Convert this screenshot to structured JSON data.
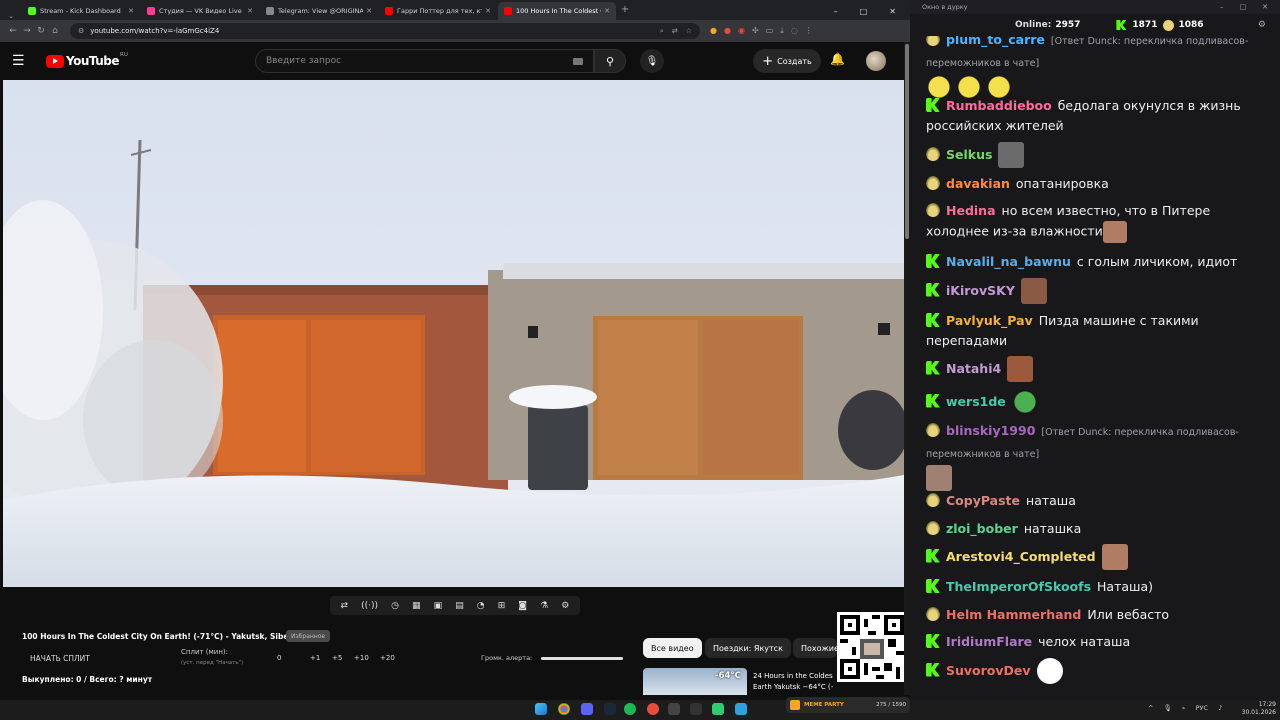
{
  "browser": {
    "tabs": [
      {
        "title": "Stream - Kick Dashboard",
        "color": "#53fc18"
      },
      {
        "title": "Студия — VK Видео Live",
        "color": "#ff3b8d"
      },
      {
        "title": "Telegram: View @ORIGINALDA",
        "color": "#888888"
      },
      {
        "title": "Гарри Поттер для тех, кто вы",
        "color": "#ff0000"
      },
      {
        "title": "100 Hours In The Coldest C",
        "color": "#ff0000"
      }
    ],
    "new_tab": "+",
    "url": "youtube.com/watch?v=-laGmGc4iZ4",
    "window_controls": [
      "–",
      "□",
      "✕"
    ]
  },
  "youtube": {
    "logo_text": "YouTube",
    "region": "RU",
    "search_placeholder": "Введите запрос",
    "create_label": "Создать"
  },
  "panel": {
    "video_title": "100 Hours In The Coldest City On Earth! (-71°C) - Yakutsk, Siberia",
    "favorite_label": "Избранное",
    "split_button": "НАЧАТЬ СПЛИТ",
    "split_label": "Сплит (мин):",
    "split_hint": "(уст. перед \"Начать\")",
    "split_values": [
      "0",
      "+1",
      "+5",
      "+10",
      "+20"
    ],
    "alert_volume_label": "Громк. алерта:",
    "alert_volume_level": 1.0,
    "bought": "Выкуплено: 0 / Всего: ? минут"
  },
  "recommendations": {
    "chips": [
      "Все видео",
      "Поездки: Якутск",
      "Похожие"
    ],
    "item_title_1": "24 Hours in the Coldest",
    "item_title_2": "Earth Yakutsk −64°C (−83°F)",
    "item_temp": "-64°C"
  },
  "chat_window": {
    "title": "Окно в дурку",
    "online_label": "Online:",
    "online_count": "2957",
    "kick_count": "1871",
    "other_count": "1086"
  },
  "chat": [
    {
      "badge": "p",
      "user": "",
      "color": "#4fb3ff",
      "text": "",
      "reply": "[Ответ Dunck: перекличка подливасов-",
      "reply2": "переможников в чате]",
      "emotes": 3
    },
    {
      "badge": "k",
      "user": "Rumbaddieboo",
      "color": "#ff6b9a",
      "text": "бедолага окунулся в жизнь российских жителей"
    },
    {
      "badge": "p",
      "user": "Selkus",
      "color": "#7bd46a",
      "text": "",
      "emote": "#6b6b6b"
    },
    {
      "badge": "p",
      "user": "davakian",
      "color": "#ff8a3d",
      "text": "опатанировка"
    },
    {
      "badge": "p",
      "user": "Hedina",
      "color": "#ff6b9a",
      "text": "но всем известно, что в Питере холоднее из-за влажности",
      "emote": "#b07c64"
    },
    {
      "badge": "k",
      "user": "Navalil_na_bawnu",
      "color": "#5dade2",
      "text": "с голым личиком, идиот"
    },
    {
      "badge": "k",
      "user": "iKirovSKY",
      "color": "#c39bd3",
      "text": "",
      "emote": "#8a5a44"
    },
    {
      "badge": "k",
      "user": "Pavlyuk_Pav",
      "color": "#f5b041",
      "text": "Пизда машине с такими перепадами"
    },
    {
      "badge": "k",
      "user": "Natahi4",
      "color": "#c39bd3",
      "text": "",
      "emote": "#9c5a3c"
    },
    {
      "badge": "k",
      "user": "wers1de",
      "color": "#48c9b0",
      "text": "",
      "emote": "#4caf50"
    },
    {
      "badge": "p",
      "user": "blinskiy1990",
      "color": "#a569bd",
      "text": "",
      "reply": "[Ответ Dunck: перекличка подливасов-",
      "reply2": "переможников в чате]",
      "emote": "#a08070"
    },
    {
      "badge": "p",
      "user": "CopyPaste",
      "color": "#d98880",
      "text": "наташа"
    },
    {
      "badge": "p",
      "user": "zloi_bober",
      "color": "#58d68d",
      "text": "наташка"
    },
    {
      "badge": "k",
      "user": "Arestovi4_Completed",
      "color": "#f7dc6f",
      "text": "",
      "emote": "#b07c64"
    },
    {
      "badge": "k",
      "user": "TheImperorOfSkoofs",
      "color": "#48c9b0",
      "text": "Наташа)"
    },
    {
      "badge": "p",
      "user": "Helm Hammerhand",
      "color": "#ec7063",
      "text": "Или вебасто"
    },
    {
      "badge": "k",
      "user": "IridiumFlare",
      "color": "#af7ac5",
      "text": "челох наташа"
    },
    {
      "badge": "k",
      "user": "SuvorovDev",
      "color": "#ec7063",
      "text": "",
      "emote": "#ffffff"
    }
  ],
  "taskbar": {
    "lang": "РУС",
    "time": "17:29",
    "date": "30.01.2026",
    "popup_title": "MEME PARTY",
    "popup_count": "275 / 1590"
  }
}
